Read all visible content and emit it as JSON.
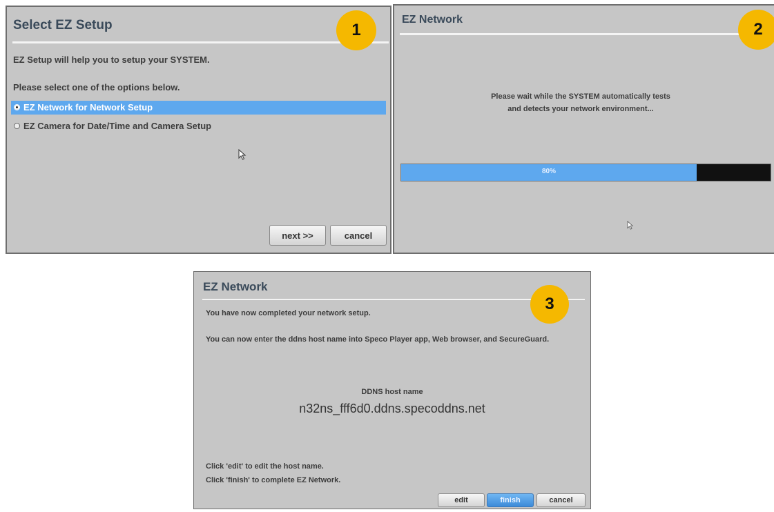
{
  "panel1": {
    "title": "Select EZ Setup",
    "badge": "1",
    "intro": "EZ Setup will help you to setup your SYSTEM.",
    "prompt": "Please select one of the options below.",
    "options": [
      {
        "label": "EZ Network for Network Setup",
        "selected": true
      },
      {
        "label": "EZ Camera for Date/Time and Camera Setup",
        "selected": false
      }
    ],
    "next_label": "next >>",
    "cancel_label": "cancel"
  },
  "panel2": {
    "title": "EZ Network",
    "badge": "2",
    "message_line1": "Please wait while the SYSTEM automatically tests",
    "message_line2": "and detects your network environment...",
    "progress_text": "80%",
    "progress_value": 0.8
  },
  "panel3": {
    "title": "EZ Network",
    "badge": "3",
    "line1": "You have now completed your network setup.",
    "line2": "You can now enter the ddns host name into Speco Player app, Web browser, and SecureGuard.",
    "ddns_label": "DDNS host name",
    "ddns_value": "n32ns_fff6d0.ddns.specoddns.net",
    "hint1": "Click 'edit' to edit the host name.",
    "hint2": "Click 'finish' to complete EZ Network.",
    "edit_label": "edit",
    "finish_label": "finish",
    "cancel_label": "cancel"
  },
  "colors": {
    "panel_bg": "#c6c6c6",
    "selection": "#5ea8ee",
    "progress_fill": "#5ea8ee",
    "progress_track": "#111111",
    "badge": "#f5b800"
  }
}
